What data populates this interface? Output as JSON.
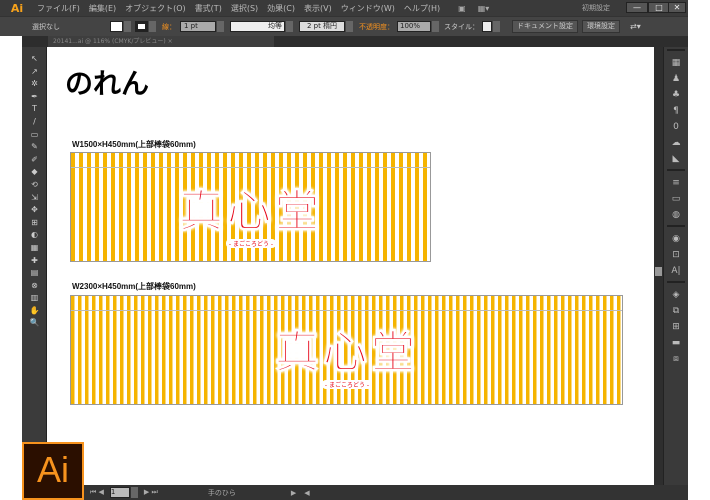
{
  "app": {
    "logo": "Ai",
    "workspace": "初期設定"
  },
  "menu": [
    "ファイル(F)",
    "編集(E)",
    "オブジェクト(O)",
    "書式(T)",
    "選択(S)",
    "効果(C)",
    "表示(V)",
    "ウィンドウ(W)",
    "ヘルプ(H)"
  ],
  "window_buttons": [
    "—",
    "□",
    "✕"
  ],
  "control": {
    "selection": "選択なし",
    "stroke_label": "線：",
    "stroke_weight": "1 pt",
    "stroke_profile": "均等",
    "brush": "2 pt 楕円",
    "opacity_label": "不透明度：",
    "opacity": "100%",
    "style_label": "スタイル：",
    "doc_setup": "ドキュメント設定",
    "prefs": "環境設定"
  },
  "document_tab": "20141...ai @ 116% (CMYK/プレビュー)",
  "tools": [
    "↖",
    "↗",
    "✲",
    "✒",
    "T",
    "/",
    "▭",
    "✎",
    "✐",
    "◆",
    "⟲",
    "⇲",
    "✥",
    "⊞",
    "◐",
    "▦",
    "✚",
    "▤",
    "⊗",
    "▥",
    "✋",
    "🔍"
  ],
  "panels": [
    "▦",
    "♟",
    "♣",
    "¶",
    "0",
    "☁",
    "◣",
    "≡",
    "▭",
    "◍",
    "◉",
    "⊡",
    "A|",
    "◈",
    "⧉",
    "⊞",
    "▬",
    "⧈"
  ],
  "status": {
    "zoom": "116%",
    "page": "1",
    "tool": "手のひら"
  },
  "canvas": {
    "title": "のれん",
    "banners": [
      {
        "label": "W1500×H450mm(上部棒袋60mm)",
        "logo": "真心堂",
        "logo_sub": "- まごころどう -"
      },
      {
        "label": "W2300×H450mm(上部棒袋60mm)",
        "logo": "真心堂",
        "logo_sub": "- まごころどう -"
      }
    ]
  },
  "colors": {
    "stripe": "#f5b400",
    "logo": "#e60012",
    "ai_orange": "#f7931e"
  }
}
